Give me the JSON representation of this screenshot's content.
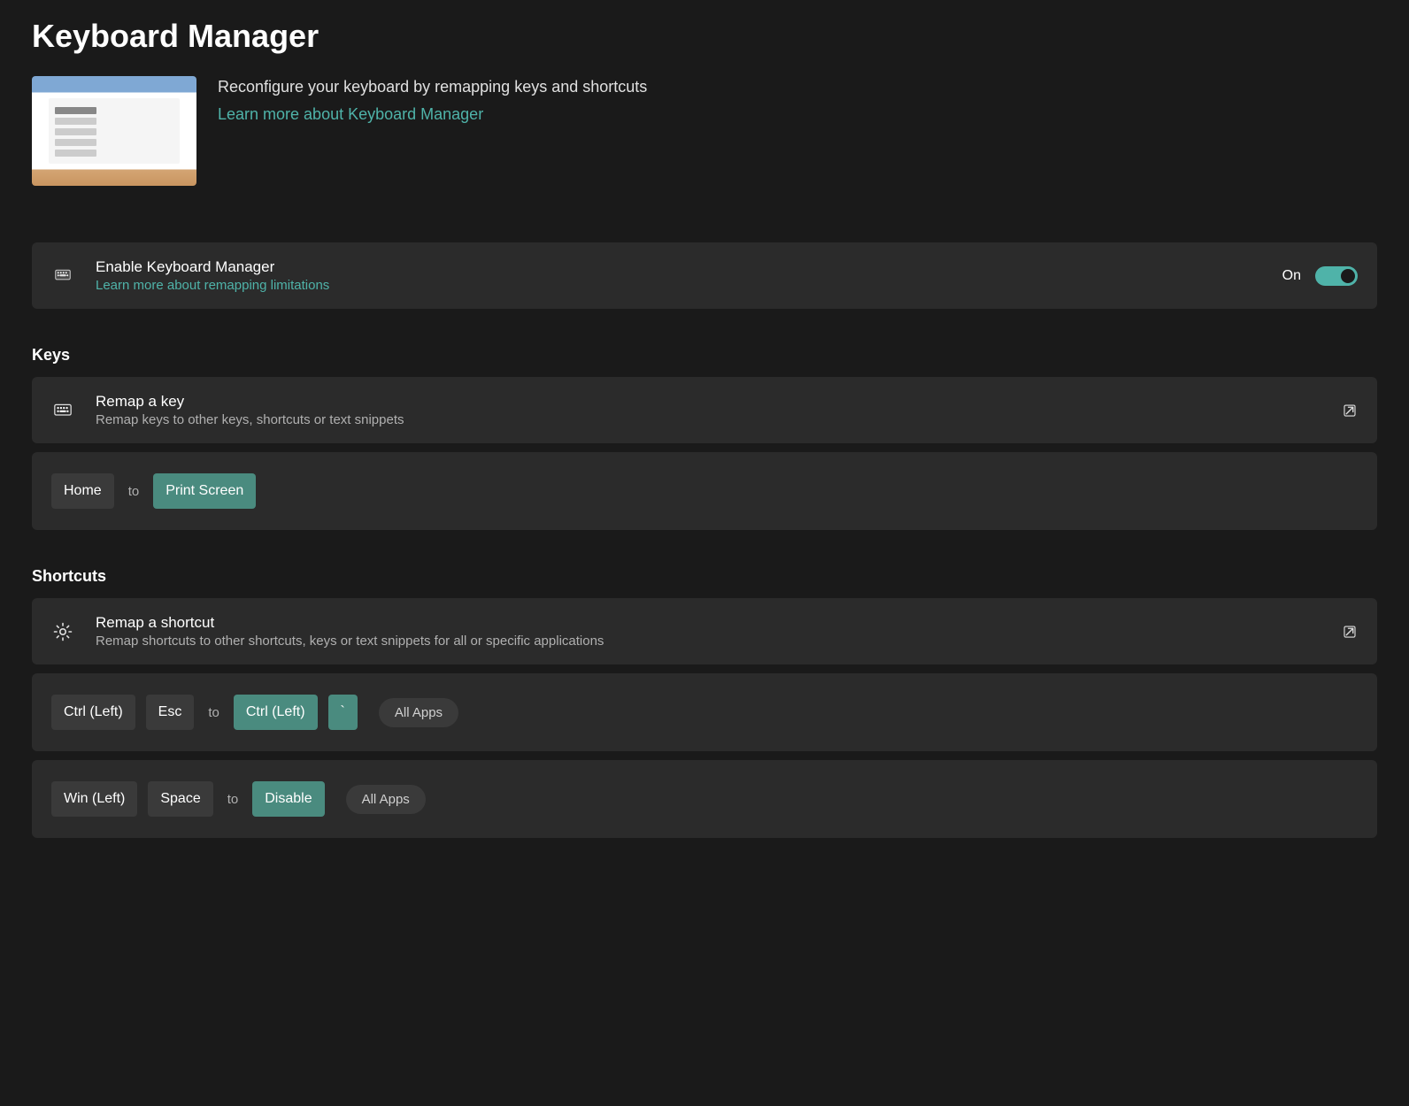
{
  "page": {
    "title": "Keyboard Manager",
    "description": "Reconfigure your keyboard by remapping keys and shortcuts",
    "learn_more": "Learn more about Keyboard Manager"
  },
  "enable_card": {
    "title": "Enable Keyboard Manager",
    "learn_more": "Learn more about remapping limitations",
    "toggle_label": "On",
    "toggle_state": true
  },
  "keys_section": {
    "header": "Keys",
    "remap_card": {
      "title": "Remap a key",
      "subtitle": "Remap keys to other keys, shortcuts or text snippets"
    },
    "mappings": [
      {
        "from": [
          "Home"
        ],
        "to_label": "to",
        "to": [
          "Print Screen"
        ]
      }
    ]
  },
  "shortcuts_section": {
    "header": "Shortcuts",
    "remap_card": {
      "title": "Remap a shortcut",
      "subtitle": "Remap shortcuts to other shortcuts, keys or text snippets for all or specific applications"
    },
    "mappings": [
      {
        "from": [
          "Ctrl (Left)",
          "Esc"
        ],
        "to_label": "to",
        "to": [
          "Ctrl (Left)",
          "`"
        ],
        "scope": "All Apps"
      },
      {
        "from": [
          "Win (Left)",
          "Space"
        ],
        "to_label": "to",
        "to": [
          "Disable"
        ],
        "scope": "All Apps"
      }
    ]
  }
}
